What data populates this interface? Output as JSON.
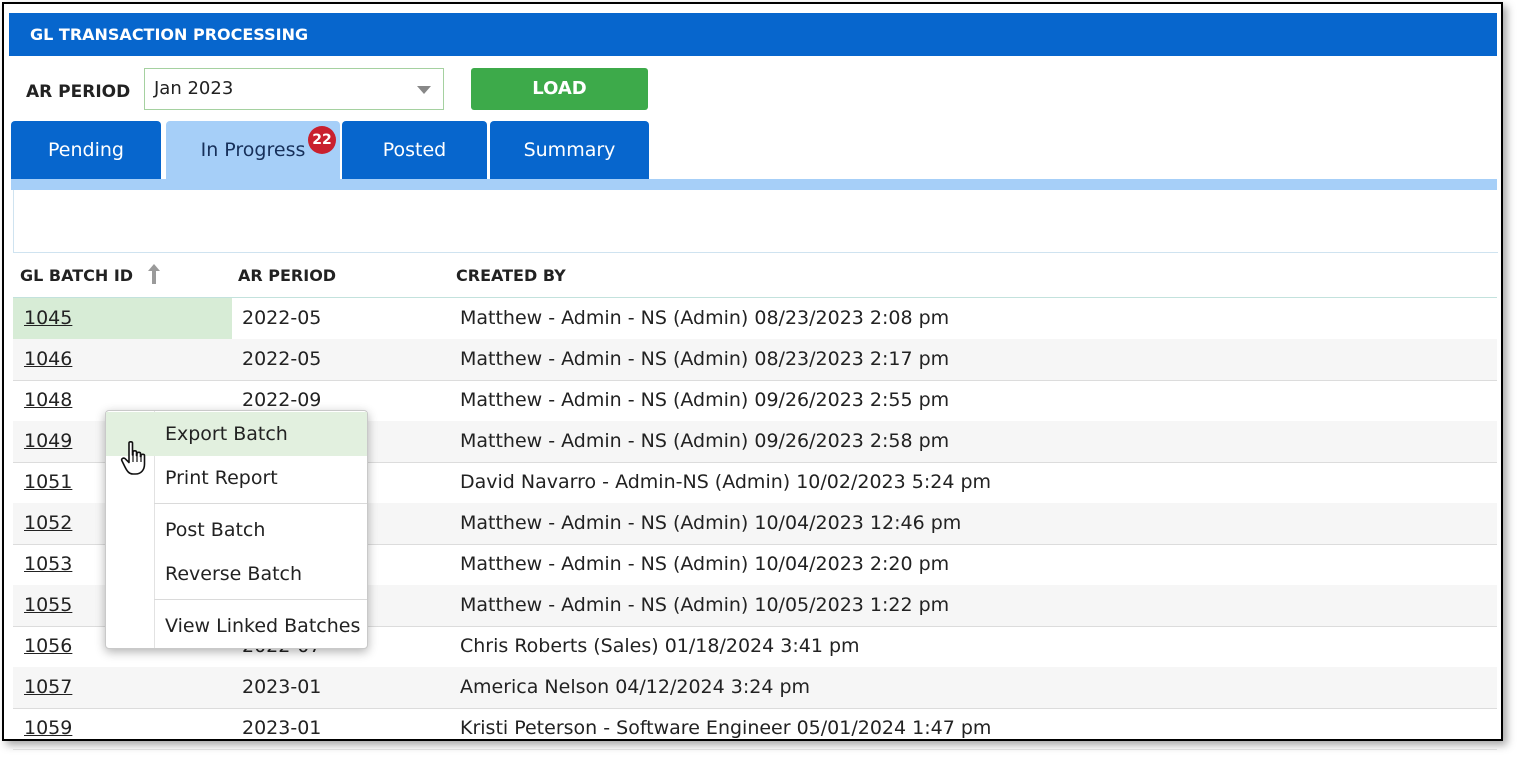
{
  "header": {
    "title": "GL TRANSACTION PROCESSING"
  },
  "filter": {
    "ar_period_label": "AR PERIOD",
    "period_value": "Jan 2023",
    "load_label": "LOAD"
  },
  "tabs": [
    {
      "label": "Pending"
    },
    {
      "label": "In Progress",
      "badge": "22",
      "active": true
    },
    {
      "label": "Posted"
    },
    {
      "label": "Summary"
    }
  ],
  "table": {
    "columns": [
      "GL BATCH ID",
      "AR PERIOD",
      "CREATED BY"
    ],
    "sort": {
      "column": "GL BATCH ID",
      "direction": "ascending",
      "icon": "arrow-up-icon"
    },
    "rows": [
      {
        "id": "1045",
        "period": "2022-05",
        "created": "Matthew - Admin - NS (Admin)  08/23/2023 2:08 pm"
      },
      {
        "id": "1046",
        "period": "2022-05",
        "created": "Matthew - Admin - NS (Admin)  08/23/2023 2:17 pm"
      },
      {
        "id": "1048",
        "period": "2022-09",
        "created": "Matthew - Admin - NS (Admin)  09/26/2023 2:55 pm"
      },
      {
        "id": "1049",
        "period": "",
        "created": "Matthew - Admin - NS (Admin)  09/26/2023 2:58 pm"
      },
      {
        "id": "1051",
        "period": "",
        "created": "David Navarro - Admin-NS (Admin)  10/02/2023 5:24 pm"
      },
      {
        "id": "1052",
        "period": "",
        "created": "Matthew - Admin - NS (Admin)  10/04/2023 12:46 pm"
      },
      {
        "id": "1053",
        "period": "",
        "created": "Matthew - Admin - NS (Admin)  10/04/2023 2:20 pm"
      },
      {
        "id": "1055",
        "period": "",
        "created": "Matthew - Admin - NS (Admin)  10/05/2023 1:22 pm"
      },
      {
        "id": "1056",
        "period": "2022-07",
        "created": "Chris Roberts (Sales)  01/18/2024 3:41 pm"
      },
      {
        "id": "1057",
        "period": "2023-01",
        "created": "America Nelson  04/12/2024 3:24 pm"
      },
      {
        "id": "1059",
        "period": "2023-01",
        "created": "Kristi Peterson - Software Engineer  05/01/2024 1:47 pm"
      }
    ]
  },
  "context_menu": {
    "items": [
      "Export Batch",
      "Print Report",
      "Post Batch",
      "Reverse Batch",
      "View Linked Batches"
    ],
    "hovered": "Export Batch"
  },
  "colors": {
    "header_blue": "#0766cd",
    "active_tab": "#a6cff8",
    "load_green": "#3daa4a",
    "badge_red": "#c9202e",
    "selected_cell": "#d7ecd6"
  }
}
